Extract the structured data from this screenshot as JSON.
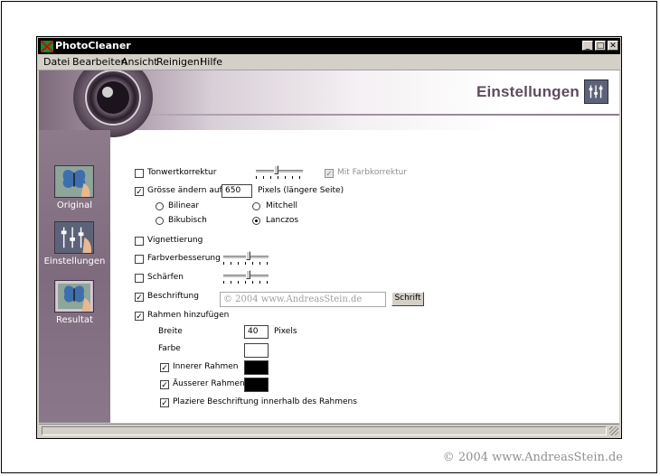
{
  "window": {
    "title": "PhotoCleaner",
    "controls": {
      "minimize": "_",
      "maximize": "□",
      "close": "✕"
    }
  },
  "menu": [
    {
      "label": "Datei"
    },
    {
      "label": "Bearbeiten"
    },
    {
      "label": "Ansicht"
    },
    {
      "label": "Reinigen!"
    },
    {
      "label": "Hilfe"
    }
  ],
  "header": {
    "title": "Einstellungen",
    "logo_icon": "einstellungen-logo-icon"
  },
  "sidebar": {
    "items": [
      {
        "label": "Original",
        "icon": "butterfly-photo-icon"
      },
      {
        "label": "Einstellungen",
        "icon": "settings-sliders-icon"
      },
      {
        "label": "Resultat",
        "icon": "butterfly-result-icon"
      }
    ]
  },
  "settings": {
    "tonwert": {
      "label": "Tonwertkorrektur",
      "checked": false,
      "slider_level": 0.5
    },
    "farbkorrektur": {
      "label": "Mit Farbkorrektur",
      "checked": true,
      "disabled": true
    },
    "groesse": {
      "label": "Grösse ändern auf",
      "checked": true,
      "value": "650",
      "unit": "Pixels (längere Seite)"
    },
    "resample": [
      {
        "label": "Bilinear",
        "checked": false
      },
      {
        "label": "Mitchell",
        "checked": false
      },
      {
        "label": "Bikubisch",
        "checked": false
      },
      {
        "label": "Lanczos",
        "checked": true
      }
    ],
    "vignettierung": {
      "label": "Vignettierung",
      "checked": false
    },
    "farbverbesserung": {
      "label": "Farbverbesserung",
      "checked": false,
      "slider_level": 0.55
    },
    "schaerfen": {
      "label": "Schärfen",
      "checked": false,
      "slider_level": 0.55
    },
    "beschriftung": {
      "label": "Beschriftung",
      "checked": true,
      "value": "© 2004 www.AndreasStein.de",
      "button": "Schrift"
    },
    "rahmen": {
      "label": "Rahmen hinzufügen",
      "checked": true,
      "breite_label": "Breite",
      "breite_value": "40",
      "breite_unit": "Pixels",
      "farbe_label": "Farbe",
      "farbe_color": "#ffffff",
      "innerer": {
        "label": "Innerer Rahmen",
        "checked": true,
        "color": "#000000"
      },
      "aeusserer": {
        "label": "Äusserer Rahmen",
        "checked": true,
        "color": "#000000"
      },
      "plaziere": {
        "label": "Plaziere Beschriftung innerhalb des Rahmens",
        "checked": true
      }
    }
  },
  "colors": {
    "sidebar": "#8d7b8c",
    "header_text": "#5e4c5f",
    "titlebar": "#000000"
  },
  "copyright": "© 2004 www.AndreasStein.de"
}
